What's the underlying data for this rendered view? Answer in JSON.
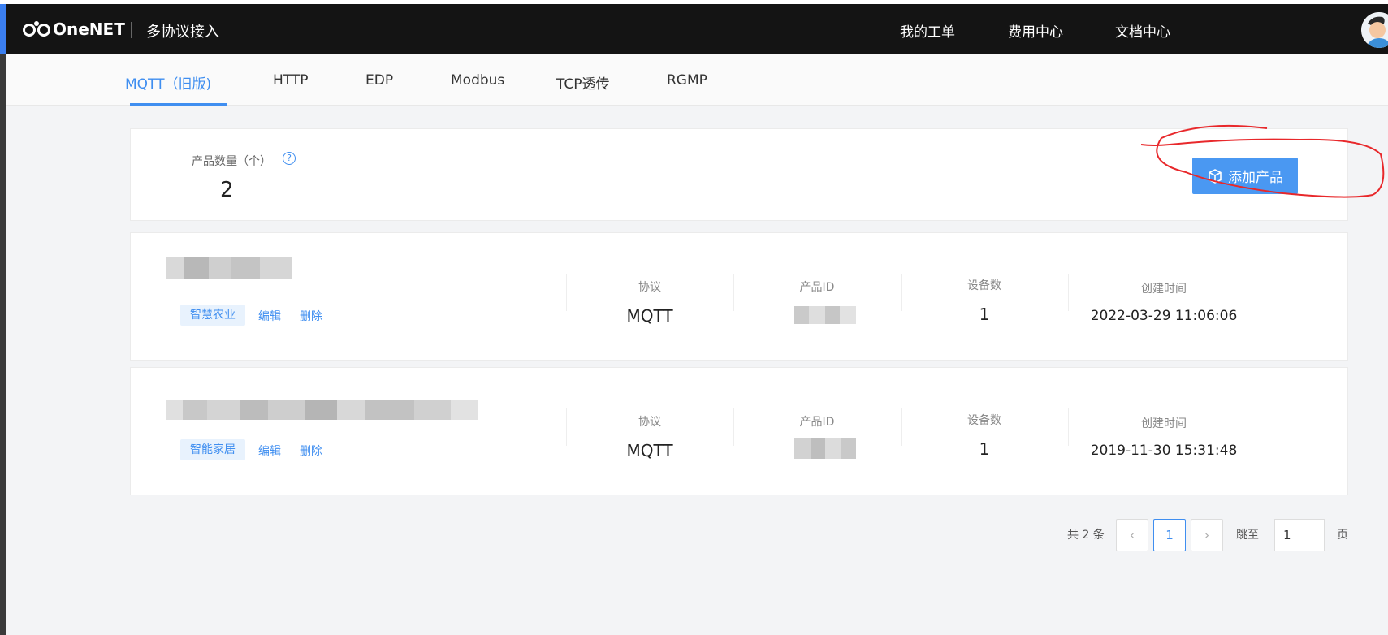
{
  "header": {
    "logo_text": "OneNET",
    "title": "多协议接入",
    "nav": [
      "我的工单",
      "费用中心",
      "文档中心"
    ]
  },
  "tabs": [
    {
      "label": "MQTT（旧版)",
      "active": true
    },
    {
      "label": "HTTP",
      "active": false
    },
    {
      "label": "EDP",
      "active": false
    },
    {
      "label": "Modbus",
      "active": false
    },
    {
      "label": "TCP透传",
      "active": false
    },
    {
      "label": "RGMP",
      "active": false
    }
  ],
  "summary": {
    "label": "产品数量（个）",
    "help": "?",
    "count": "2",
    "add_button": "添加产品"
  },
  "products": [
    {
      "tag": "智慧农业",
      "edit": "编辑",
      "delete": "删除",
      "protocol_label": "协议",
      "protocol": "MQTT",
      "pid_label": "产品ID",
      "devices_label": "设备数",
      "devices": "1",
      "created_label": "创建时间",
      "created": "2022-03-29 11:06:06"
    },
    {
      "tag": "智能家居",
      "edit": "编辑",
      "delete": "删除",
      "protocol_label": "协议",
      "protocol": "MQTT",
      "pid_label": "产品ID",
      "devices_label": "设备数",
      "devices": "1",
      "created_label": "创建时间",
      "created": "2019-11-30 15:31:48"
    }
  ],
  "pagination": {
    "total": "共 2 条",
    "prev": "‹",
    "current": "1",
    "next": "›",
    "jump_label": "跳至",
    "jump_value": "1",
    "page_label": "页"
  },
  "colors": {
    "accent": "#3f8ef0",
    "button": "#4a98f2",
    "header": "#141414",
    "annotation": "#e8282b"
  }
}
